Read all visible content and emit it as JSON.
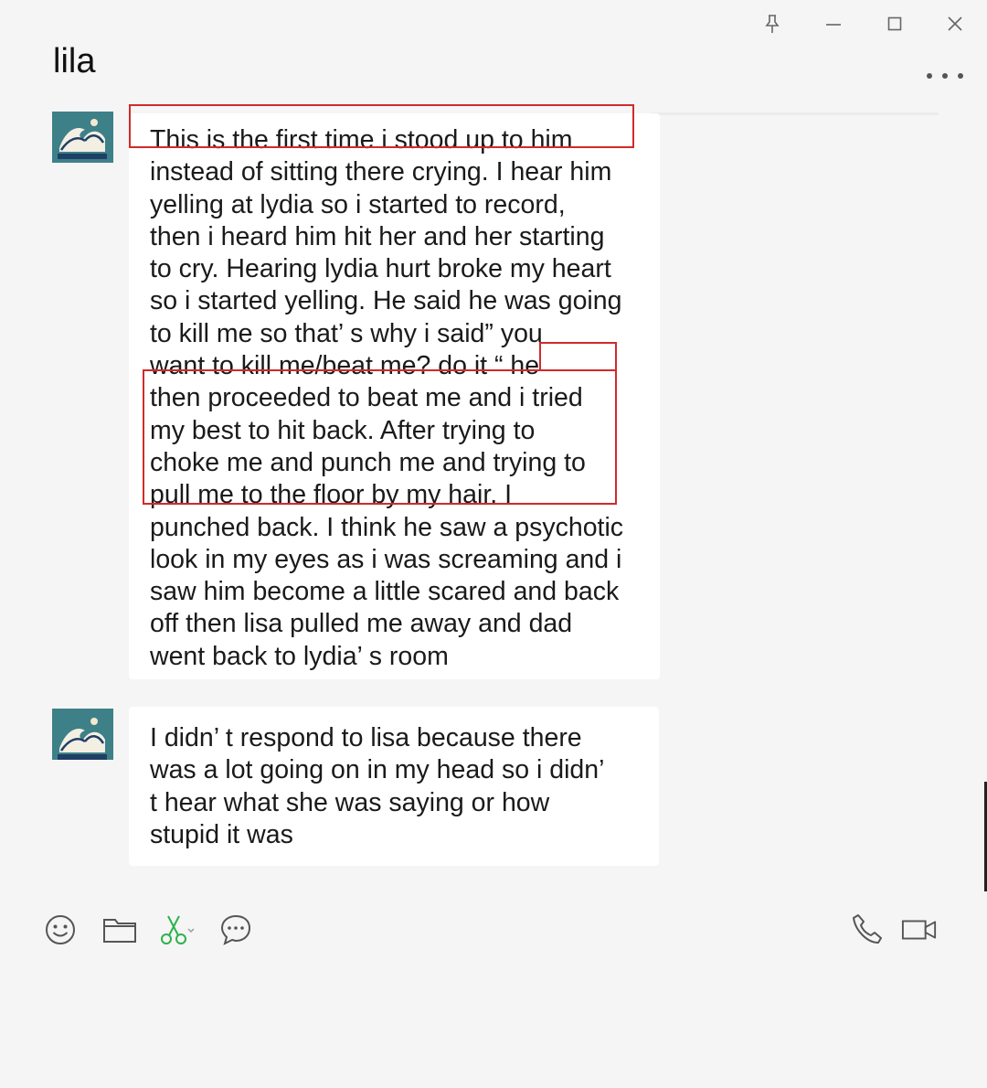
{
  "window": {
    "title": "lila",
    "controls": [
      "pin-icon",
      "minimize-icon",
      "maximize-icon",
      "close-icon"
    ],
    "more_menu_icon": "more-dots-icon"
  },
  "messages": [
    {
      "sender_avatar": "wave-painting-avatar",
      "lines": [
        "This is the first time i stood up to him",
        "instead of sitting there crying. I hear him",
        "yelling at lydia so i started to record,",
        "then i heard him hit her and her starting",
        "to cry. Hearing lydia hurt broke my heart",
        "so i started yelling. He said he was going",
        "to kill me so that’ s why i said” you",
        "want to kill me/beat me? do it “ he",
        "then proceeded to beat me and i tried",
        "my best to hit back. After trying to",
        "choke me and punch me and trying to",
        "pull me to the floor by my hair. I",
        "punched back. I think he saw a psychotic",
        "look in my eyes as i was screaming and i",
        "saw him become a little scared and back",
        "off then lisa pulled me away and dad",
        "went back to lydia’ s room"
      ]
    },
    {
      "sender_avatar": "wave-painting-avatar",
      "lines": [
        "I didn’ t respond to lisa because there",
        "was a lot going on in my head so i didn’",
        "t hear what she was saying or how",
        "stupid it was"
      ]
    }
  ],
  "annotations": {
    "highlight_color": "#d22a2a"
  },
  "toolbar": {
    "left_icons": [
      "emoji-icon",
      "folder-icon",
      "scissors-icon",
      "chat-bubble-icon"
    ],
    "right_icons": [
      "phone-icon",
      "video-call-icon"
    ],
    "scissors_color": "#2bb24c"
  }
}
